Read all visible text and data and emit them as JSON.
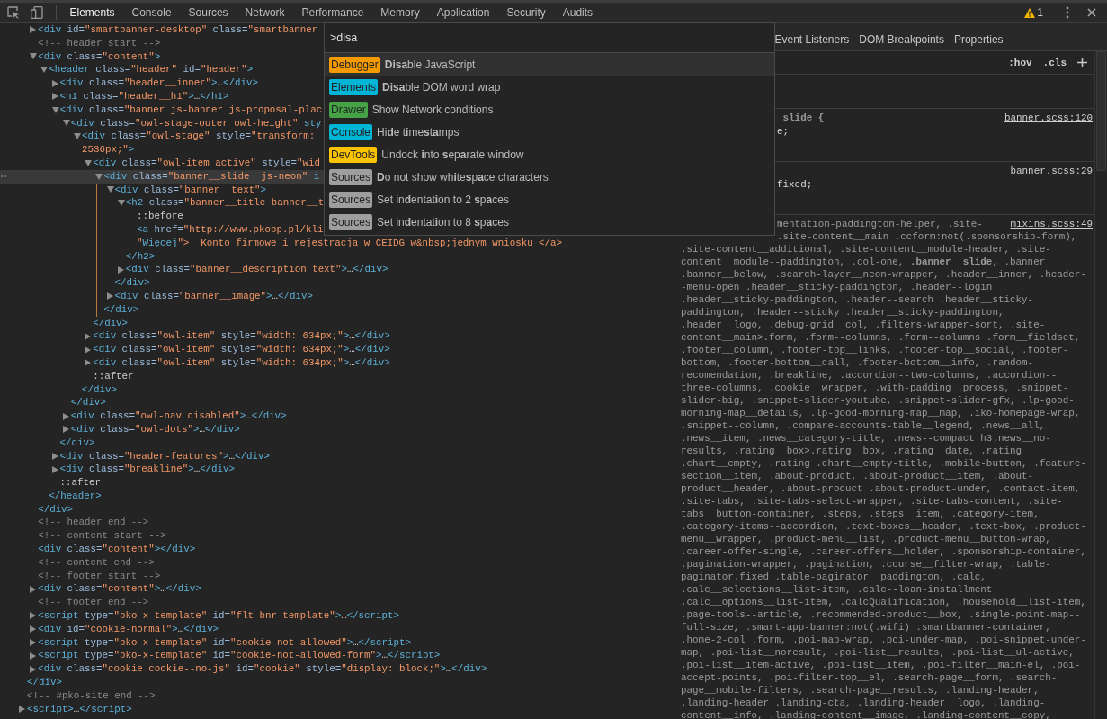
{
  "toolbar": {
    "tabs": [
      {
        "label": "Elements",
        "selected": true
      },
      {
        "label": "Console",
        "selected": false
      },
      {
        "label": "Sources",
        "selected": false
      },
      {
        "label": "Network",
        "selected": false
      },
      {
        "label": "Performance",
        "selected": false
      },
      {
        "label": "Memory",
        "selected": false
      },
      {
        "label": "Application",
        "selected": false
      },
      {
        "label": "Security",
        "selected": false
      },
      {
        "label": "Audits",
        "selected": false
      }
    ],
    "warning_count": "1"
  },
  "elements": {
    "tree": [
      {
        "kind": "element",
        "selected": false,
        "close": "</div>",
        "children": [
          {
            "kind": "element",
            "selected": false,
            "expanded": false,
            "open": [
              "<div id=\"smartbanner-desktop\" class=\"smartbanner"
            ]
          },
          {
            "kind": "comment",
            "selected": false,
            "open": [
              "<!-- header start -->"
            ]
          },
          {
            "kind": "element",
            "selected": false,
            "expanded": true,
            "open": [
              "<div class=\"content\">"
            ],
            "close": "</div>",
            "children": [
              {
                "kind": "element",
                "selected": false,
                "expanded": true,
                "open": [
                  "<header class=\"header\" id=\"header\">"
                ],
                "close": "</header>",
                "children": [
                  {
                    "kind": "element",
                    "selected": false,
                    "expanded": false,
                    "open": [
                      "<div class=\"header__inner\">…</div>"
                    ]
                  },
                  {
                    "kind": "element",
                    "selected": false,
                    "expanded": false,
                    "open": [
                      "<h1 class=\"header__h1\">…</h1>"
                    ]
                  },
                  {
                    "kind": "element",
                    "selected": false,
                    "expanded": true,
                    "open": [
                      "<div class=\"banner js-banner js-proposal-plac"
                    ],
                    "close": "</div>",
                    "children": [
                      {
                        "kind": "element",
                        "selected": false,
                        "expanded": true,
                        "open": [
                          "<div class=\"owl-stage-outer owl-height\" sty"
                        ],
                        "close": "</div>",
                        "children": [
                          {
                            "kind": "element",
                            "selected": false,
                            "expanded": true,
                            "open": [
                              "<div class=\"owl-stage\" style=\"transform:",
                              "2536px;\">"
                            ],
                            "close": "</div>",
                            "children": [
                              {
                                "kind": "element",
                                "selected": false,
                                "expanded": true,
                                "open": [
                                  "<div class=\"owl-item active\" style=\"wid"
                                ],
                                "close": "</div>",
                                "children": [
                                  {
                                    "kind": "element",
                                    "selected": true,
                                    "expanded": true,
                                    "open": [
                                      "<div class=\"banner__slide  js-neon\" i"
                                    ],
                                    "close": "</div>",
                                    "children": [
                                      {
                                        "kind": "element",
                                        "selected": false,
                                        "expanded": true,
                                        "open": [
                                          "<div class=\"banner__text\">"
                                        ],
                                        "close": "</div>",
                                        "children": [
                                          {
                                            "kind": "element",
                                            "selected": false,
                                            "expanded": true,
                                            "open": [
                                              "<h2 class=\"banner__title banner__t"
                                            ],
                                            "close": "</h2>",
                                            "children": [
                                              {
                                                "kind": "pseudo",
                                                "selected": false,
                                                "open": [
                                                  "::before"
                                                ]
                                              },
                                              {
                                                "kind": "element",
                                                "selected": false,
                                                "open": [
                                                  "<a href=\"http://www.pkobp.pl/kli",
                                                  "\"Więcej\">  Konto firmowe i rejestracja w CEIDG w&nbsp;jednym wniosku </a>"
                                                ]
                                              }
                                            ]
                                          },
                                          {
                                            "kind": "element",
                                            "selected": false,
                                            "expanded": false,
                                            "open": [
                                              "<div class=\"banner__description text\">…</div>"
                                            ]
                                          }
                                        ]
                                      },
                                      {
                                        "kind": "element",
                                        "selected": false,
                                        "expanded": false,
                                        "open": [
                                          "<div class=\"banner__image\">…</div>"
                                        ]
                                      }
                                    ]
                                  }
                                ]
                              },
                              {
                                "kind": "element",
                                "selected": false,
                                "expanded": false,
                                "open": [
                                  "<div class=\"owl-item\" style=\"width: 634px;\">…</div>"
                                ]
                              },
                              {
                                "kind": "element",
                                "selected": false,
                                "expanded": false,
                                "open": [
                                  "<div class=\"owl-item\" style=\"width: 634px;\">…</div>"
                                ]
                              },
                              {
                                "kind": "element",
                                "selected": false,
                                "expanded": false,
                                "open": [
                                  "<div class=\"owl-item\" style=\"width: 634px;\">…</div>"
                                ]
                              },
                              {
                                "kind": "pseudo",
                                "selected": false,
                                "open": [
                                  "::after"
                                ]
                              }
                            ]
                          }
                        ]
                      },
                      {
                        "kind": "element",
                        "selected": false,
                        "expanded": false,
                        "open": [
                          "<div class=\"owl-nav disabled\">…</div>"
                        ]
                      },
                      {
                        "kind": "element",
                        "selected": false,
                        "expanded": false,
                        "open": [
                          "<div class=\"owl-dots\">…</div>"
                        ]
                      }
                    ]
                  },
                  {
                    "kind": "element",
                    "selected": false,
                    "expanded": false,
                    "open": [
                      "<div class=\"header-features\">…</div>"
                    ]
                  },
                  {
                    "kind": "element",
                    "selected": false,
                    "expanded": false,
                    "open": [
                      "<div class=\"breakline\">…</div>"
                    ]
                  },
                  {
                    "kind": "pseudo",
                    "selected": false,
                    "open": [
                      "::after"
                    ]
                  }
                ]
              }
            ]
          },
          {
            "kind": "comment",
            "selected": false,
            "open": [
              "<!-- header end -->"
            ]
          },
          {
            "kind": "comment",
            "selected": false,
            "open": [
              "<!-- content start -->"
            ]
          },
          {
            "kind": "element",
            "selected": false,
            "open": [
              "<div class=\"content\"></div>"
            ]
          },
          {
            "kind": "comment",
            "selected": false,
            "open": [
              "<!-- content end -->"
            ]
          },
          {
            "kind": "comment",
            "selected": false,
            "open": [
              "<!-- footer start -->"
            ]
          },
          {
            "kind": "element",
            "selected": false,
            "expanded": false,
            "open": [
              "<div class=\"content\">…</div>"
            ]
          },
          {
            "kind": "comment",
            "selected": false,
            "open": [
              "<!-- footer end -->"
            ]
          },
          {
            "kind": "element",
            "selected": false,
            "expanded": false,
            "open": [
              "<script type=\"pko-x-template\" id=\"flt-bnr-template\">…</script>"
            ]
          },
          {
            "kind": "element",
            "selected": false,
            "expanded": false,
            "open": [
              "<div id=\"cookie-normal\">…</div>"
            ]
          },
          {
            "kind": "element",
            "selected": false,
            "expanded": false,
            "open": [
              "<script type=\"pko-x-template\" id=\"cookie-not-allowed\">…</script>"
            ]
          },
          {
            "kind": "element",
            "selected": false,
            "expanded": false,
            "open": [
              "<script type=\"pko-x-template\" id=\"cookie-not-allowed-form\">…</script>"
            ]
          },
          {
            "kind": "element",
            "selected": false,
            "expanded": false,
            "open": [
              "<div class=\"cookie cookie--no-js\" id=\"cookie\" style=\"display: block;\">…</div>"
            ]
          }
        ]
      },
      {
        "kind": "comment",
        "selected": false,
        "open": [
          "<!-- #pko-site end -->"
        ]
      },
      {
        "kind": "element",
        "selected": false,
        "expanded": false,
        "open": [
          "<script>…</script>"
        ]
      }
    ]
  },
  "command_menu": {
    "query": ">disa",
    "items": [
      {
        "category": "Debugger",
        "color": "#f59b00",
        "label": "**Disa**ble JavaScript",
        "selected": true
      },
      {
        "category": "Elements",
        "color": "#00b6d6",
        "label": "**Disa**ble DOM word wrap",
        "selected": false
      },
      {
        "category": "Drawer",
        "color": "#45a245",
        "label": "Show Network conditions",
        "selected": false
      },
      {
        "category": "Console",
        "color": "#00b6d6",
        "label": "Hi**d**e t**i**me**s**t**a**mps",
        "selected": false
      },
      {
        "category": "DevTools",
        "color": "#fcc400",
        "label": "Undock **i**nto **s**ep**a**rate window",
        "selected": false
      },
      {
        "category": "Sources",
        "color": "#9e9e9e",
        "label": "**D**o not show wh**i**te**s**p**a**ce characters",
        "selected": false
      },
      {
        "category": "Sources",
        "color": "#9e9e9e",
        "label": "Set in**d**entat**i**on to 2 **s**p**a**ces",
        "selected": false
      },
      {
        "category": "Sources",
        "color": "#9e9e9e",
        "label": "Set in**d**entat**i**on to 8 **s**p**a**ces",
        "selected": false
      }
    ]
  },
  "sidebar": {
    "tabs": [
      {
        "label": "Event Listeners",
        "selected": false
      },
      {
        "label": "DOM Breakpoints",
        "selected": false
      },
      {
        "label": "Properties",
        "selected": false
      }
    ],
    "toolbar": [
      ":hov",
      ".cls"
    ],
    "rules": [
      {
        "source": "banner.scss:120",
        "selector": [
          {
            "text": "**_slide {**",
            "cut": true
          }
        ],
        "declarations": [
          {
            "text": "e;",
            "cut": true
          }
        ]
      },
      {
        "source": "banner.scss:29",
        "declarations": [
          {
            "text": "fixed;",
            "cut": true
          }
        ]
      },
      {
        "source": "mixins.scss:49",
        "selector": [
          {
            "text": "mentation-paddington-helper, .site-",
            "cut": true
          },
          {
            "text": ".site-content__main .ccform:not(.sponsorship-form),",
            "cut": true
          },
          {
            "text": ".site-content__additional, .site-content__module-header, .site-",
            "cut": false
          },
          {
            "text": "content__module--paddington, .col-one, **.banner__slide,** .banner",
            "cut": false
          },
          {
            "text": ".banner__below, .search-layer__neon-wrapper, .header__inner, .header-",
            "cut": false
          },
          {
            "text": "-menu-open .header__sticky-paddington, .header--login",
            "cut": false
          },
          {
            "text": ".header__sticky-paddington, .header--search .header__sticky-",
            "cut": false
          },
          {
            "text": "paddington, .header--sticky .header__sticky-paddington,",
            "cut": false
          },
          {
            "text": ".header__logo, .debug-grid__col, .filters-wrapper-sort, .site-",
            "cut": false
          },
          {
            "text": "content__main>.form, .form--columns, .form--columns .form__fieldset,",
            "cut": false
          },
          {
            "text": ".footer__column, .footer-top__links, .footer-top__social, .footer-",
            "cut": false
          },
          {
            "text": "bottom, .footer-bottom__call, .footer-bottom__info, .random-",
            "cut": false
          },
          {
            "text": "recomendation, .breakline, .accordion--two-columns, .accordion--",
            "cut": false
          },
          {
            "text": "three-columns, .cookie__wrapper, .with-padding .process, .snippet-",
            "cut": false
          },
          {
            "text": "slider-big, .snippet-slider-youtube, .snippet-slider-gfx, .lp-good-",
            "cut": false
          },
          {
            "text": "morning-map__details, .lp-good-morning-map__map, .iko-homepage-wrap,",
            "cut": false
          },
          {
            "text": ".snippet--column, .compare-accounts-table__legend, .news__all,",
            "cut": false
          },
          {
            "text": ".news__item, .news__category-title, .news--compact h3.news__no-",
            "cut": false
          },
          {
            "text": "results, .rating__box>.rating__box, .rating__date, .rating",
            "cut": false
          },
          {
            "text": ".chart__empty, .rating .chart__empty-title, .mobile-button, .feature-",
            "cut": false
          },
          {
            "text": "section__item, .about-product, .about-product__item, .about-",
            "cut": false
          },
          {
            "text": "product__header, .about-product .about-product-under, .contact-item,",
            "cut": false
          },
          {
            "text": ".site-tabs, .site-tabs-select-wrapper, .site-tabs-content, .site-",
            "cut": false
          },
          {
            "text": "tabs__button-container, .steps, .steps__item, .category-item,",
            "cut": false
          },
          {
            "text": ".category-items--accordion, .text-boxes__header, .text-box, .product-",
            "cut": false
          },
          {
            "text": "menu__wrapper, .product-menu__list, .product-menu__button-wrap,",
            "cut": false
          },
          {
            "text": ".career-offer-single, .career-offers__holder, .sponsorship-container,",
            "cut": false
          },
          {
            "text": ".pagination-wrapper, .pagination, .course__filter-wrap, .table-",
            "cut": false
          },
          {
            "text": "paginator.fixed .table-paginator__paddington, .calc,",
            "cut": false
          },
          {
            "text": ".calc__selections__list-item, .calc--loan-installment",
            "cut": false
          },
          {
            "text": ".calc__options__list-item, .calcQualification, .household__list-item,",
            "cut": false
          },
          {
            "text": ".page-tools--article, .recommended-product__box, .single-point-map--",
            "cut": false
          },
          {
            "text": "full-size, .smart-app-banner:not(.wifi) .smartbanner-container,",
            "cut": false
          },
          {
            "text": ".home-2-col .form, .poi-map-wrap, .poi-under-map, .poi-snippet-under-",
            "cut": false
          },
          {
            "text": "map, .poi-list__noresult, .poi-list__results, .poi-list__ul-active,",
            "cut": false
          },
          {
            "text": ".poi-list__item-active, .poi-list__item, .poi-filter__main-el, .poi-",
            "cut": false
          },
          {
            "text": "accept-points, .poi-filter-top__el, .search-page__form, .search-",
            "cut": false
          },
          {
            "text": "page__mobile-filters, .search-page__results, .landing-header,",
            "cut": false
          },
          {
            "text": ".landing-header .landing-cta, .landing-header__logo, .landing-",
            "cut": false
          },
          {
            "text": "content__info, .landing-content__image, .landing-content__copy,",
            "cut": false
          }
        ]
      }
    ]
  }
}
